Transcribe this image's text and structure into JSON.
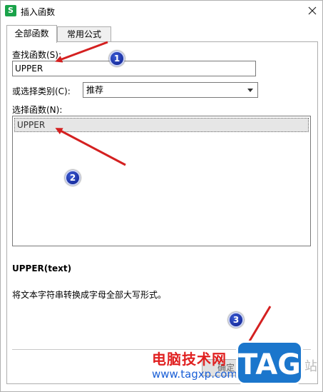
{
  "window": {
    "app_badge": "S",
    "title": "插入函数"
  },
  "tabs": [
    {
      "label": "全部函数",
      "active": true
    },
    {
      "label": "常用公式",
      "active": false
    }
  ],
  "search": {
    "label": "查找函数(S):",
    "value": "UPPER"
  },
  "category": {
    "label": "或选择类别(C):",
    "value": "推荐"
  },
  "functions": {
    "label": "选择函数(N):",
    "items": [
      "UPPER"
    ]
  },
  "signature": "UPPER(text)",
  "description": "将文本字符串转换成字母全部大写形式。",
  "buttons": {
    "ok_label": "确定"
  },
  "annotations": [
    "1",
    "2",
    "3"
  ],
  "watermark": {
    "site_name": "电脑技术网",
    "url": "www.tagxp.com",
    "badge": "TAG",
    "trailing": "站"
  },
  "colors": {
    "annotation_arrow": "#d42020",
    "annotation_circle": "#1a2aa8",
    "app_icon": "#1aa34a"
  }
}
